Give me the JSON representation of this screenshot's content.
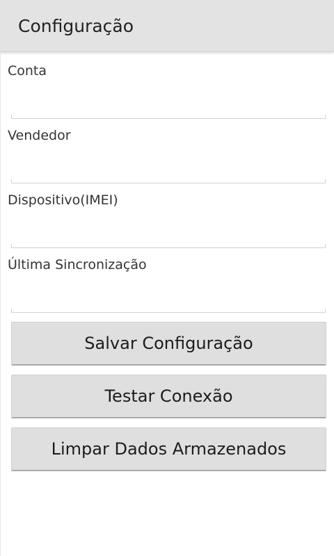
{
  "action_bar": {
    "title": "Configuração"
  },
  "form": {
    "fields": [
      {
        "label": "Conta",
        "value": ""
      },
      {
        "label": "Vendedor",
        "value": ""
      },
      {
        "label": "Dispositivo(IMEI)",
        "value": ""
      },
      {
        "label": "Última Sincronização",
        "value": ""
      }
    ]
  },
  "buttons": {
    "save": "Salvar Configuração",
    "test_connection": "Testar Conexão",
    "clear_data": "Limpar Dados Armazenados"
  },
  "colors": {
    "action_bar_bg": "#e3e3e3",
    "background": "#ffffff",
    "button_bg": "#dfdfdf",
    "text": "#333333"
  }
}
